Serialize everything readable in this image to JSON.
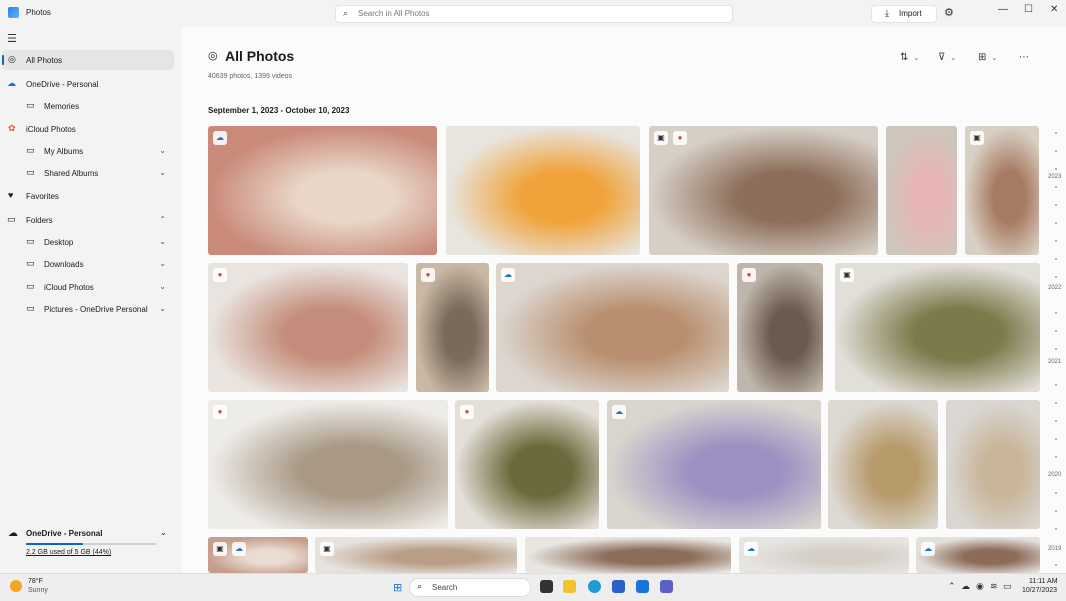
{
  "window": {
    "app_title": "Photos",
    "search_placeholder": "Search in All Photos",
    "import_label": "Import",
    "icons": {
      "search": "search-icon",
      "import": "import-icon",
      "settings": "gear-icon",
      "minimize": "minimize-icon",
      "maximize": "maximize-icon",
      "close": "close-icon"
    }
  },
  "sidebar": {
    "items": [
      {
        "label": "All Photos",
        "icon": "photos-icon",
        "active": true
      },
      {
        "label": "OneDrive - Personal",
        "icon": "cloud-icon"
      },
      {
        "label": "Memories",
        "icon": "memories-icon"
      },
      {
        "label": "iCloud Photos",
        "icon": "icloud-icon"
      },
      {
        "label": "My Albums",
        "icon": "album-icon"
      },
      {
        "label": "Shared Albums",
        "icon": "album-icon"
      },
      {
        "label": "Favorites",
        "icon": "heart-icon"
      },
      {
        "label": "Folders",
        "icon": "folder-icon"
      },
      {
        "label": "Desktop",
        "icon": "folder-icon"
      },
      {
        "label": "Downloads",
        "icon": "folder-icon"
      },
      {
        "label": "iCloud Photos",
        "icon": "folder-icon"
      },
      {
        "label": "Pictures - OneDrive Personal",
        "icon": "folder-icon"
      }
    ],
    "storage": {
      "title": "OneDrive - Personal",
      "usage_text": "2.2 GB used of 5 GB (44%)",
      "usage_fraction": 0.44
    }
  },
  "main": {
    "title": "All Photos",
    "subtitle": "40639 photos, 1399 videos",
    "date_range": "September 1, 2023 - October 10, 2023",
    "toolbar_icons": [
      "sort-icon",
      "filter-icon",
      "view-options-icon",
      "more-icon"
    ],
    "photos": [
      {
        "badge": "cloud"
      },
      {
        "badge": ""
      },
      {
        "badge": "cam-dot"
      },
      {
        "badge": ""
      },
      {
        "badge": "cam"
      },
      {
        "badge": "dot"
      },
      {
        "badge": "dot"
      },
      {
        "badge": "cloud"
      },
      {
        "badge": "dot"
      },
      {
        "badge": "cam"
      },
      {
        "badge": "dot"
      },
      {
        "badge": "dot"
      },
      {
        "badge": "cloud"
      },
      {
        "badge": ""
      },
      {
        "badge": ""
      },
      {
        "badge": "cam-cloud"
      },
      {
        "badge": "cam"
      },
      {
        "badge": ""
      },
      {
        "badge": "cloud"
      },
      {
        "badge": "cloud"
      }
    ],
    "timeline_years": [
      "2023",
      "2022",
      "2021",
      "2020",
      "2019"
    ]
  },
  "taskbar": {
    "weather_temp": "78°F",
    "weather_condition": "Sunny",
    "search_label": "Search",
    "time": "11:11 AM",
    "date": "10/27/2023"
  },
  "colors": {
    "accent": "#0a64c8",
    "sidebar_bg": "#f3f3f3",
    "main_bg": "#fbfbfb"
  }
}
